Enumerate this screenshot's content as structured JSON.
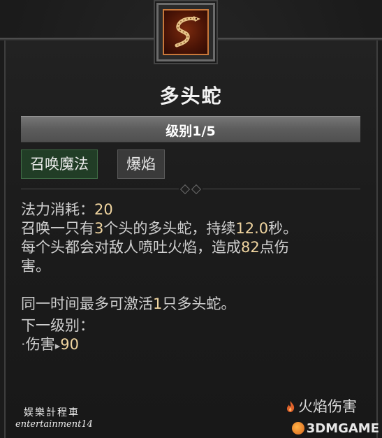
{
  "skill": {
    "icon": "hydra-serpent-icon",
    "title": "多头蛇",
    "rank_label": "级别1/5",
    "tags": [
      "召唤魔法",
      "爆焰"
    ],
    "tag_colors": {
      "summon_bg": "#213d26",
      "fire_bg": "#3a3a3a"
    }
  },
  "description": {
    "mana_label": "法力消耗：",
    "mana_value": "20",
    "line1_a": "召唤一只有",
    "heads": "3",
    "line1_b": "个头的多头蛇，持续",
    "duration": "12.0",
    "line1_c": "秒。",
    "line2_a": "每个头都会对敌人喷吐火焰，造成",
    "damage": "82",
    "line2_b": "点伤",
    "line3": "害。",
    "line4_a": "同一时间最多可激活",
    "max_active": "1",
    "line4_b": "只多头蛇。",
    "next_rank_label": "下一级别：",
    "next_bullet": "·",
    "next_stat": "伤害",
    "next_arrow": "▸",
    "next_value": "90",
    "number_color": "#f0d5a0"
  },
  "footer": {
    "damage_type_icon": "flame-icon",
    "damage_type": "火焰伤害"
  },
  "watermarks": {
    "cn": "娱樂計程車",
    "en": "entertainment14",
    "site": "3DMGAME"
  }
}
